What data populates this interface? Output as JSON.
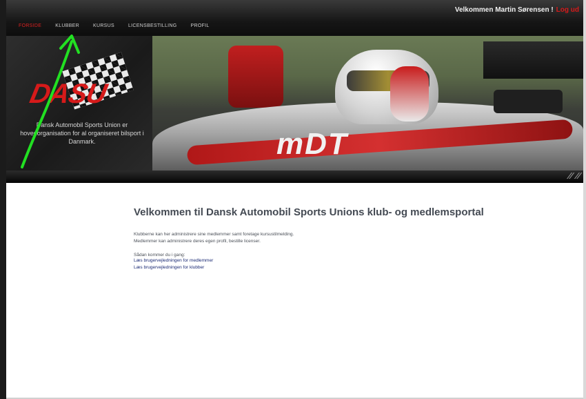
{
  "header": {
    "welcome": "Velkommen Martin Sørensen !",
    "logout_label": "Log ud"
  },
  "nav": {
    "items": [
      {
        "label": "FORSIDE",
        "active": true
      },
      {
        "label": "KLUBBER",
        "active": false
      },
      {
        "label": "KURSUS",
        "active": false
      },
      {
        "label": "LICENSBESTILLING",
        "active": false
      },
      {
        "label": "PROFIL",
        "active": false
      }
    ]
  },
  "banner": {
    "logo": "DASU",
    "tagline": "Dansk Automobil Sports Union er hovedorganisation for al organiseret bilsport i Danmark.",
    "car_text": "mDT"
  },
  "main": {
    "title": "Velkommen til Dansk Automobil Sports Unions klub- og medlemsportal",
    "intro_line1": "Klubberne kan her administrere sine medlemmer samt foretage kursustilmelding.",
    "intro_line2": "Medlemmer kan administrere deres egen profil, bestille licenser.",
    "guide_heading": "Sådan kommer du i gang:",
    "guide_links": [
      "Læs brugervejledningen for medlemmer",
      "Læs brugervejledningen for klubber"
    ]
  },
  "colors": {
    "accent": "#d61a1a",
    "annotation_arrow": "#22e022",
    "link": "#1b2b75"
  }
}
